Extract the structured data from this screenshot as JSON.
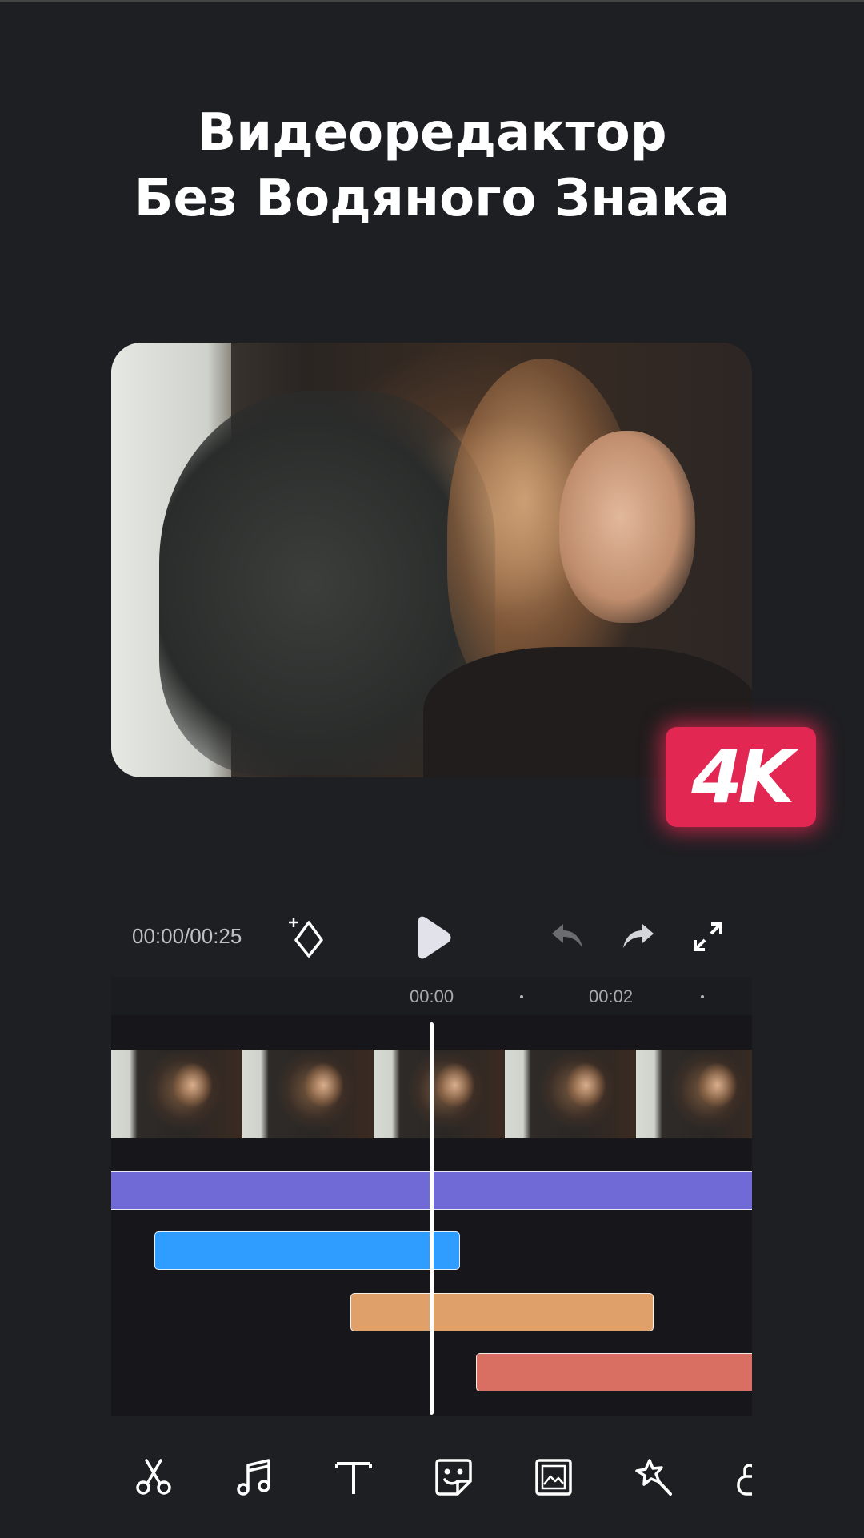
{
  "headline": {
    "line1": "Видеоредактор",
    "line2": "Без Водяного Знака"
  },
  "badge": {
    "text": "4K",
    "color": "#e22752"
  },
  "player": {
    "time_readout": "00:00/00:25",
    "icons": [
      "add-keyframe-icon",
      "play-icon",
      "undo-icon",
      "redo-icon",
      "fullscreen-icon"
    ]
  },
  "ruler": {
    "labels": [
      "00:00",
      "00:02"
    ]
  },
  "timeline": {
    "tracks": [
      {
        "name": "video-track",
        "color": "#6f6ad6"
      },
      {
        "name": "music-track",
        "color": "#2f9cff"
      },
      {
        "name": "text-track",
        "color": "#dfa06a"
      },
      {
        "name": "effect-track",
        "color": "#d86f62"
      }
    ]
  },
  "toolbar": {
    "icons": [
      "scissors-icon",
      "music-note-icon",
      "text-icon",
      "sticker-icon",
      "image-overlay-icon",
      "magic-wand-icon",
      "lock-icon"
    ]
  }
}
